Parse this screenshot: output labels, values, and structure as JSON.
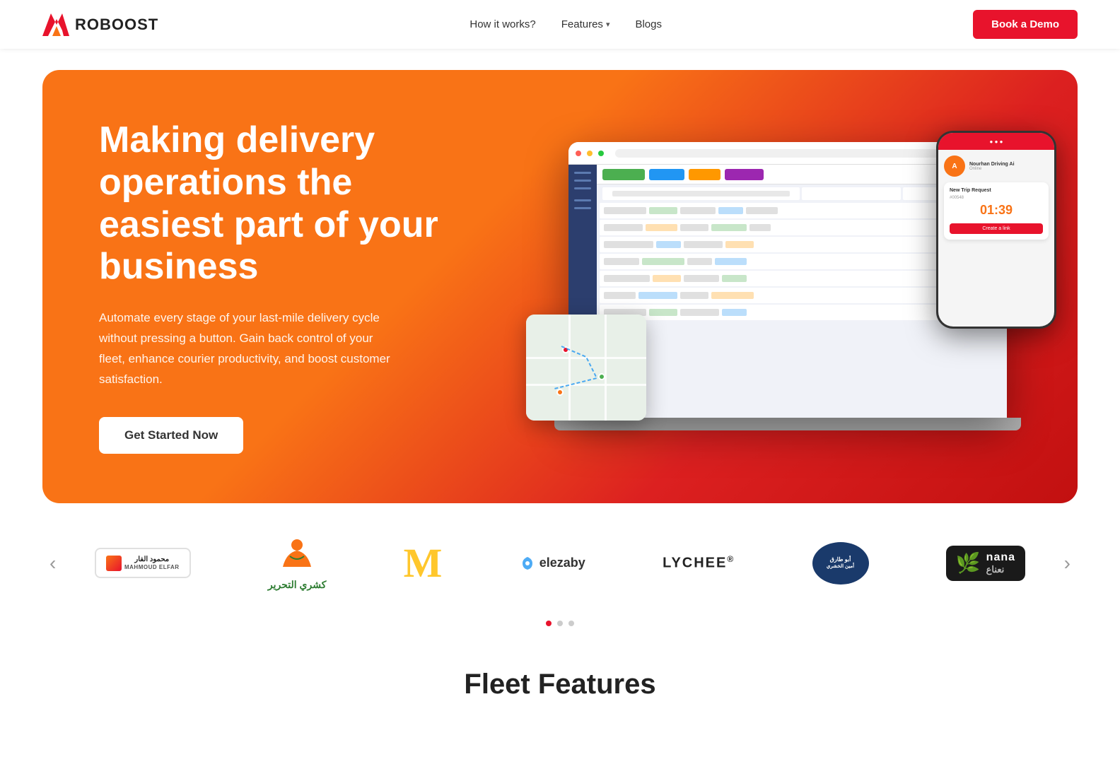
{
  "nav": {
    "logo_text": "ROBOOST",
    "links": [
      {
        "id": "how-it-works",
        "label": "How it works?"
      },
      {
        "id": "features",
        "label": "Features",
        "has_dropdown": true
      },
      {
        "id": "blogs",
        "label": "Blogs"
      }
    ],
    "cta_label": "Book a Demo"
  },
  "hero": {
    "title": "Making delivery operations the easiest part of your business",
    "subtitle": "Automate every stage of your last-mile delivery cycle without pressing a button. Gain back control of your fleet, enhance courier productivity, and boost customer satisfaction.",
    "cta_label": "Get Started Now"
  },
  "phone_card": {
    "title": "New Trip Request",
    "subtitle": "#00548",
    "timer": "01:39",
    "cta_label": "Create a link"
  },
  "clients": {
    "prev_label": "‹",
    "next_label": "›",
    "logos": [
      {
        "id": "mahmoud-elfar",
        "display": "Mahmoud\nEL FAR",
        "type": "border"
      },
      {
        "id": "kashry",
        "display": "كشري التحرير",
        "type": "kashry"
      },
      {
        "id": "mcdonalds",
        "display": "M",
        "type": "mcdonalds"
      },
      {
        "id": "elezaby",
        "display": "elezaby",
        "type": "elezaby"
      },
      {
        "id": "lychee",
        "display": "LYCHEE®",
        "type": "lychee"
      },
      {
        "id": "abutariq",
        "display": "أبو طارق\nأمين الخشري",
        "type": "abutariq"
      },
      {
        "id": "nana",
        "display": "nana نعناع",
        "type": "nana"
      }
    ],
    "dots": [
      {
        "active": true
      },
      {
        "active": false
      },
      {
        "active": false
      }
    ]
  },
  "fleet": {
    "title": "Fleet Features"
  }
}
